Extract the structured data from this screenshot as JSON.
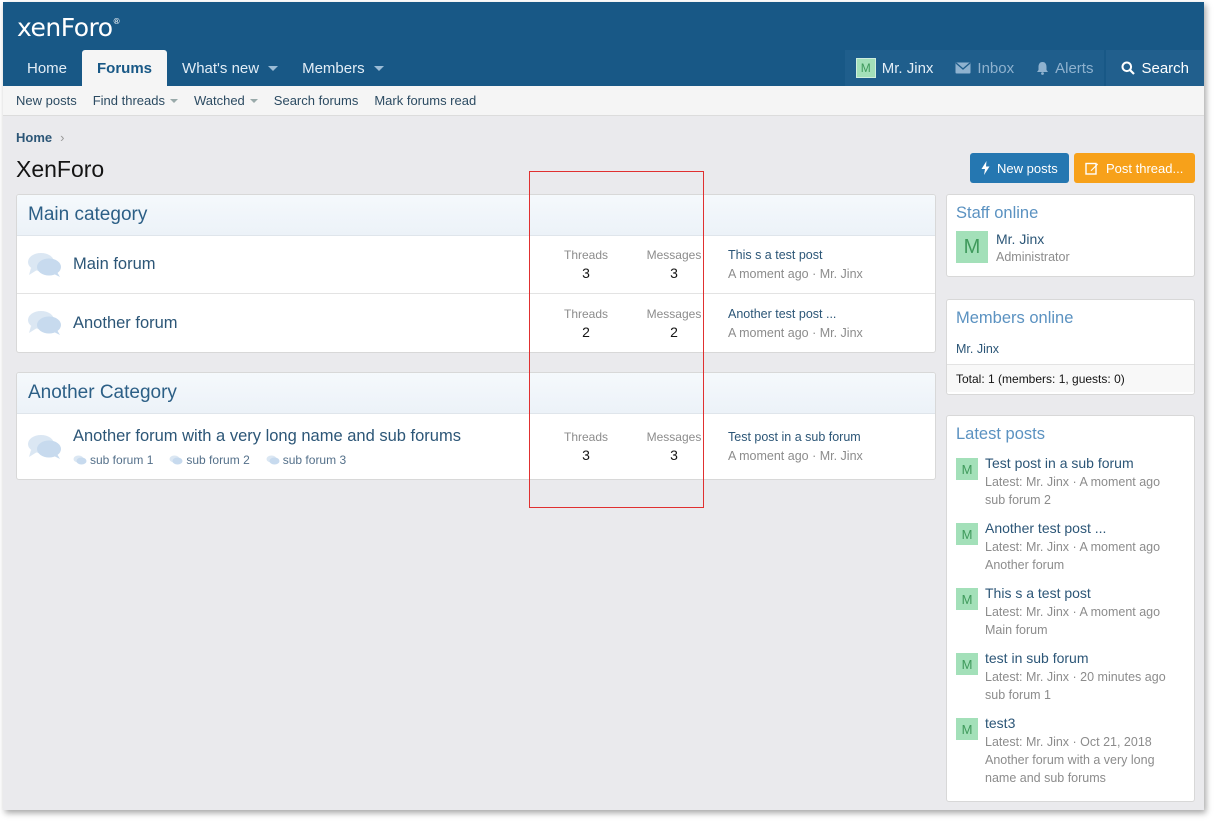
{
  "header": {
    "logo": "xenForo",
    "nav": [
      {
        "label": "Home"
      },
      {
        "label": "Forums"
      },
      {
        "label": "What's new"
      },
      {
        "label": "Members"
      }
    ],
    "user": "Mr. Jinx",
    "user_initial": "M",
    "inbox": "Inbox",
    "alerts": "Alerts",
    "search": "Search"
  },
  "subnav": [
    "New posts",
    "Find threads",
    "Watched",
    "Search forums",
    "Mark forums read"
  ],
  "breadcrumb": "Home",
  "page_title": "XenForo",
  "buttons": {
    "new_posts": "New posts",
    "post_thread": "Post thread..."
  },
  "categories": [
    {
      "title": "Main category",
      "forums": [
        {
          "title": "Main forum",
          "threads_label": "Threads",
          "threads": "3",
          "messages_label": "Messages",
          "messages": "3",
          "last_title": "This s a test post",
          "last_meta": "A moment ago · Mr. Jinx"
        },
        {
          "title": "Another forum",
          "threads_label": "Threads",
          "threads": "2",
          "messages_label": "Messages",
          "messages": "2",
          "last_title": "Another test post ...",
          "last_meta": "A moment ago · Mr. Jinx"
        }
      ]
    },
    {
      "title": "Another Category",
      "forums": [
        {
          "title": "Another forum with a very long name and sub forums",
          "subforums": [
            "sub forum 1",
            "sub forum 2",
            "sub forum 3"
          ],
          "threads_label": "Threads",
          "threads": "3",
          "messages_label": "Messages",
          "messages": "3",
          "last_title": "Test post in a sub forum",
          "last_meta": "A moment ago · Mr. Jinx"
        }
      ]
    }
  ],
  "sidebar": {
    "staff_online": {
      "title": "Staff online",
      "name": "Mr. Jinx",
      "role": "Administrator",
      "initial": "M"
    },
    "members_online": {
      "title": "Members online",
      "list": "Mr. Jinx",
      "total": "Total: 1 (members: 1, guests: 0)"
    },
    "latest_posts": {
      "title": "Latest posts",
      "items": [
        {
          "initial": "M",
          "title": "Test post in a sub forum",
          "meta": "Latest: Mr. Jinx · A moment ago",
          "forum": "sub forum 2"
        },
        {
          "initial": "M",
          "title": "Another test post ...",
          "meta": "Latest: Mr. Jinx · A moment ago",
          "forum": "Another forum"
        },
        {
          "initial": "M",
          "title": "This s a test post",
          "meta": "Latest: Mr. Jinx · A moment ago",
          "forum": "Main forum"
        },
        {
          "initial": "M",
          "title": "test in sub forum",
          "meta": "Latest: Mr. Jinx · 20 minutes ago",
          "forum": "sub forum 1"
        },
        {
          "initial": "M",
          "title": "test3",
          "meta": "Latest: Mr. Jinx · Oct 21, 2018",
          "forum": "Another forum with a very long name and sub forums"
        }
      ]
    }
  },
  "colors": {
    "header": "#185886",
    "accent": "#2577b1",
    "post_button": "#f7a11a",
    "highlight_box": "#e03030"
  }
}
